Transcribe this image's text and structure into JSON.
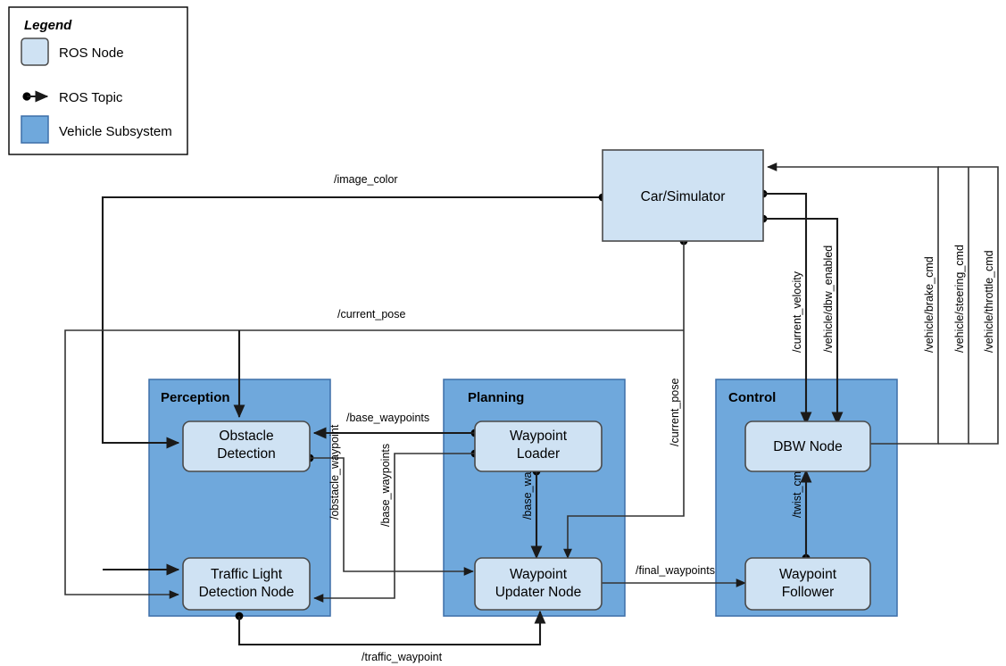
{
  "legend": {
    "title": "Legend",
    "items": [
      {
        "label": "ROS Node",
        "swatch": "ros-node",
        "color": "#CFE2F3"
      },
      {
        "label": "ROS Topic",
        "swatch": "ros-topic",
        "color": "#000000"
      },
      {
        "label": "Vehicle Subsystem",
        "swatch": "vehicle-subsystem",
        "color": "#6FA8DC"
      }
    ]
  },
  "colors": {
    "node_fill": "#CFE2F3",
    "subsystem_fill": "#6FA8DC",
    "subsystem_stroke": "#3D6FA8",
    "node_stroke": "#4A4A4A",
    "edge": "#333333",
    "background": "#FFFFFF"
  },
  "nodes": {
    "car_simulator": "Car/Simulator",
    "obstacle_detection": "Obstacle\nDetection",
    "obstacle_detection_line1": "Obstacle",
    "obstacle_detection_line2": "Detection",
    "traffic_light_line1": "Traffic Light",
    "traffic_light_line2": "Detection Node",
    "waypoint_loader_line1": "Waypoint",
    "waypoint_loader_line2": "Loader",
    "waypoint_updater_line1": "Waypoint",
    "waypoint_updater_line2": "Updater Node",
    "dbw_node": "DBW Node",
    "waypoint_follower_line1": "Waypoint",
    "waypoint_follower_line2": "Follower"
  },
  "subsystems": {
    "perception": "Perception",
    "planning": "Planning",
    "control": "Control"
  },
  "topics": {
    "image_color": "/image_color",
    "current_pose_top": "/current_pose",
    "current_pose_vertical": "/current_pose",
    "current_velocity": "/current_velocity",
    "dbw_enabled": "/vehicle/dbw_enabled",
    "brake_cmd": "/vehicle/brake_cmd",
    "steering_cmd": "/vehicle/steering_cmd",
    "throttle_cmd": "/vehicle/throttle_cmd",
    "base_waypoints_top": "/base_waypoints",
    "obstacle_waypoint": "/obstacle_waypoint",
    "base_waypoints_vertical_left": "/base_waypoints",
    "base_waypoints_vertical_planning": "/base_waypoints",
    "final_waypoints": "/final_waypoints",
    "twist_cmd": "/twist_cmd",
    "traffic_waypoint": "/traffic_waypoint"
  }
}
